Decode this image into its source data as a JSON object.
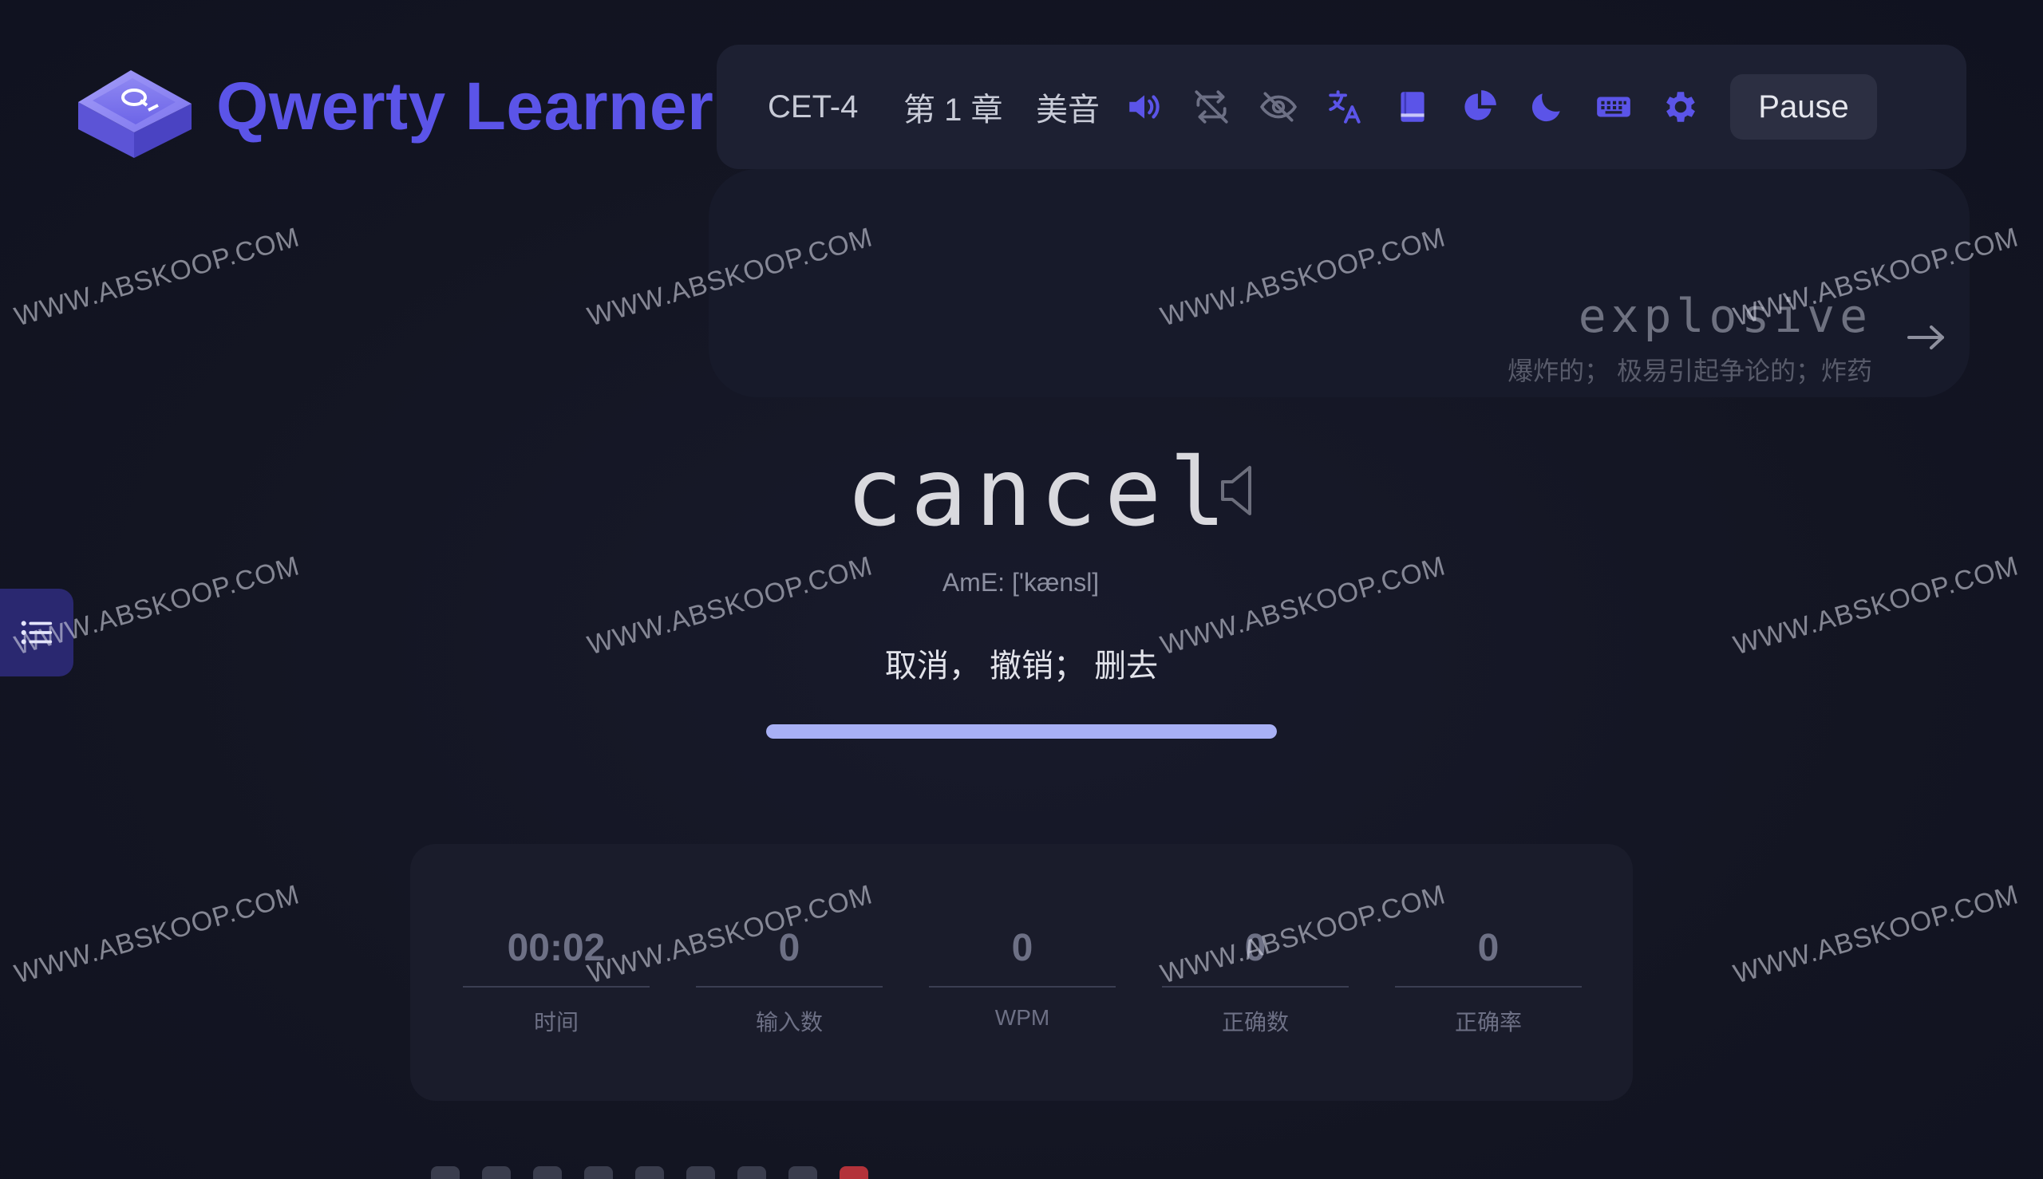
{
  "app": {
    "title": "Qwerty Learner"
  },
  "toolbar": {
    "dictionary": "CET-4",
    "chapter": "第 1 章",
    "accent": "美音",
    "pause_label": "Pause",
    "icons": [
      "speaker-icon",
      "repeat-off-icon",
      "eye-off-icon",
      "translate-icon",
      "book-icon",
      "pie-chart-icon",
      "moon-icon",
      "keyboard-icon",
      "gear-icon"
    ],
    "accent_color": "#5b54e8"
  },
  "next_word": {
    "word": "explosive",
    "translation": "爆炸的； 极易引起争论的；炸药"
  },
  "current_word": {
    "word": "cancel",
    "phonetic": "AmE: ['kænsl]",
    "meaning": "取消， 撤销； 删去"
  },
  "progress": {
    "fraction": 1.0
  },
  "stats": [
    {
      "value": "00:02",
      "label": "时间"
    },
    {
      "value": "0",
      "label": "输入数"
    },
    {
      "value": "0",
      "label": "WPM"
    },
    {
      "value": "0",
      "label": "正确数"
    },
    {
      "value": "0",
      "label": "正确率"
    }
  ],
  "watermark": "WWW.ABSKOOP.COM"
}
